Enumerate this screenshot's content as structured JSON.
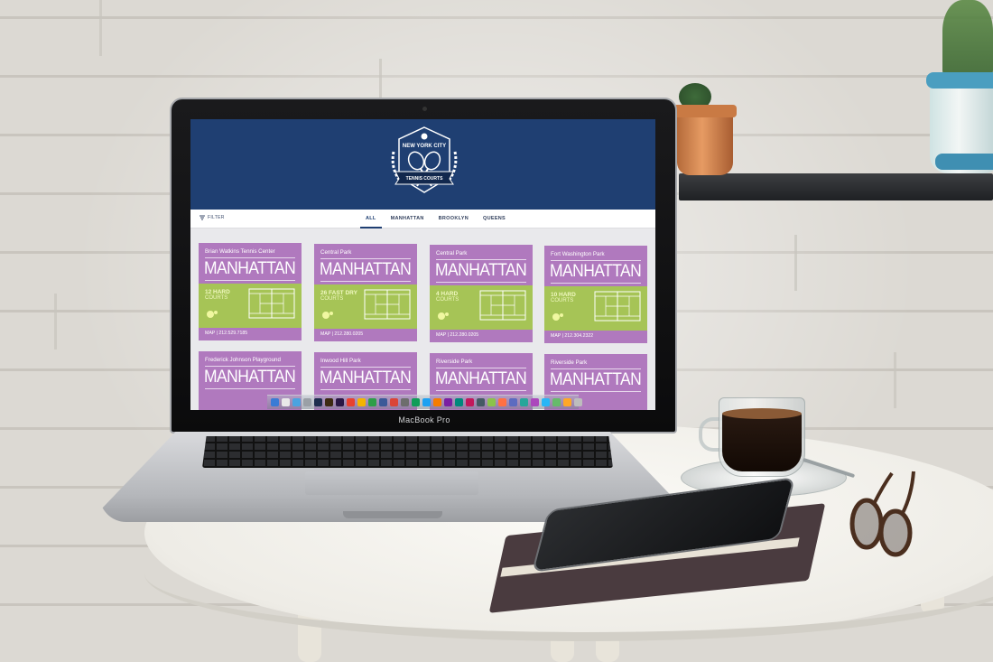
{
  "device": {
    "label": "MacBook Pro"
  },
  "site": {
    "logo": {
      "line1": "NEW YORK CITY",
      "ribbon": "TENNIS COURTS"
    },
    "filter_label": "FILTER",
    "tabs": [
      "ALL",
      "MANHATTAN",
      "BROOKLYN",
      "QUEENS"
    ],
    "active_tab": "ALL",
    "colors": {
      "header": "#1f3f72",
      "card": "#b079be",
      "card_green": "#a6c456"
    },
    "cards": [
      {
        "name": "Brian Watkins Tennis Center",
        "borough": "MANHATTAN",
        "courts": "12 HARD",
        "type": "COURTS",
        "foot": "MAP  |  212.529.7185"
      },
      {
        "name": "Central Park",
        "borough": "MANHATTAN",
        "courts": "26 FAST DRY",
        "type": "COURTS",
        "foot": "MAP  |  212.280.0205"
      },
      {
        "name": "Central Park",
        "borough": "MANHATTAN",
        "courts": "4 HARD",
        "type": "COURTS",
        "foot": "MAP  |  212.280.0205"
      },
      {
        "name": "Fort Washington Park",
        "borough": "MANHATTAN",
        "courts": "10 HARD",
        "type": "COURTS",
        "foot": "MAP  |  212.304.2322"
      },
      {
        "name": "Frederick Johnson Playground",
        "borough": "MANHATTAN"
      },
      {
        "name": "Inwood Hill Park",
        "borough": "MANHATTAN"
      },
      {
        "name": "Riverside Park",
        "borough": "MANHATTAN"
      },
      {
        "name": "Riverside Park",
        "borough": "MANHATTAN"
      }
    ]
  }
}
